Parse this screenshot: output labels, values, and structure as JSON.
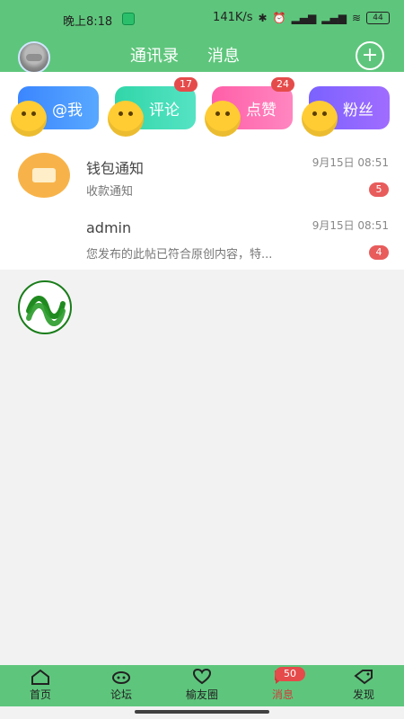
{
  "status_bar": {
    "time": "晚上8:18",
    "network_speed": "141K/s",
    "battery": "44"
  },
  "header": {
    "tabs": [
      "通讯录",
      "消息"
    ]
  },
  "cards": [
    {
      "label": "@我",
      "badge": ""
    },
    {
      "label": "评论",
      "badge": "17"
    },
    {
      "label": "点赞",
      "badge": "24"
    },
    {
      "label": "粉丝",
      "badge": ""
    }
  ],
  "messages": [
    {
      "title": "钱包通知",
      "subtitle": "收款通知",
      "time": "9月15日 08:51",
      "count": "5"
    },
    {
      "title": "admin",
      "subtitle": "您发布的此帖已符合原创内容，特...",
      "time": "9月15日 08:51",
      "count": "4"
    }
  ],
  "bottom_tabs": [
    {
      "label": "首页"
    },
    {
      "label": "论坛"
    },
    {
      "label": "榆友圈"
    },
    {
      "label": "消息",
      "badge": "50"
    },
    {
      "label": "发现"
    }
  ],
  "colors": {
    "primary_green": "#5ec67c",
    "badge_red": "#e54b4b"
  }
}
